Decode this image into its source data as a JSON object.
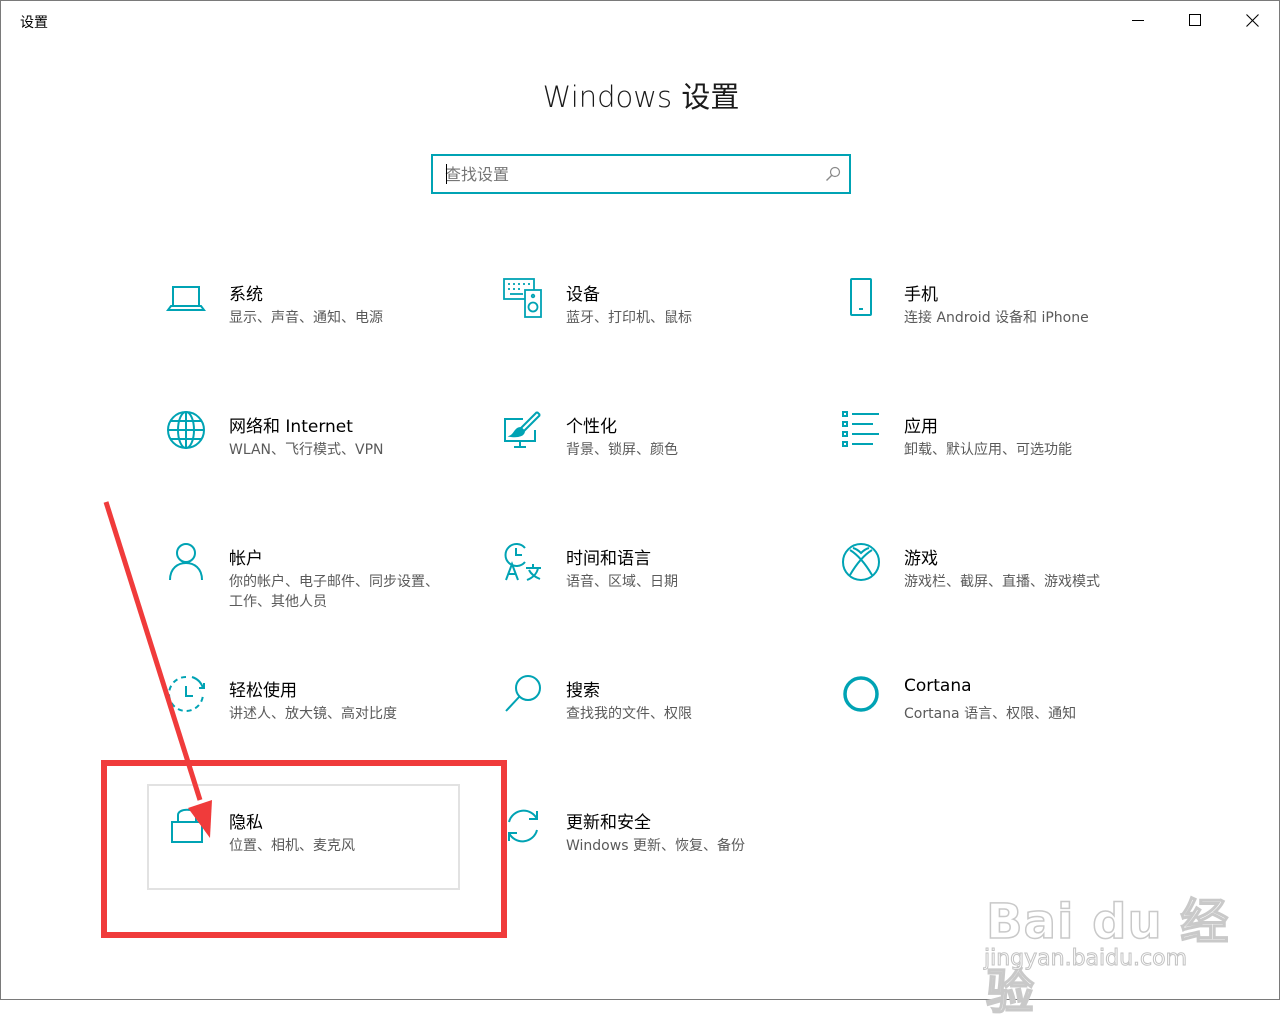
{
  "window": {
    "title": "设置"
  },
  "page": {
    "title": "Windows 设置"
  },
  "search": {
    "placeholder": "查找设置",
    "value": ""
  },
  "tiles": [
    {
      "id": "system",
      "name": "系统",
      "desc": "显示、声音、通知、电源",
      "icon": "laptop-icon"
    },
    {
      "id": "devices",
      "name": "设备",
      "desc": "蓝牙、打印机、鼠标",
      "icon": "keyboard-speaker-icon"
    },
    {
      "id": "phone",
      "name": "手机",
      "desc": "连接 Android 设备和 iPhone",
      "icon": "phone-icon"
    },
    {
      "id": "network",
      "name": "网络和 Internet",
      "desc": "WLAN、飞行模式、VPN",
      "icon": "globe-icon"
    },
    {
      "id": "personalization",
      "name": "个性化",
      "desc": "背景、锁屏、颜色",
      "icon": "paint-brush-icon"
    },
    {
      "id": "apps",
      "name": "应用",
      "desc": "卸载、默认应用、可选功能",
      "icon": "apps-list-icon"
    },
    {
      "id": "accounts",
      "name": "帐户",
      "desc": "你的帐户、电子邮件、同步设置、工作、其他人员",
      "icon": "person-icon"
    },
    {
      "id": "time-language",
      "name": "时间和语言",
      "desc": "语音、区域、日期",
      "icon": "clock-language-icon"
    },
    {
      "id": "gaming",
      "name": "游戏",
      "desc": "游戏栏、截屏、直播、游戏模式",
      "icon": "xbox-icon"
    },
    {
      "id": "ease-of-access",
      "name": "轻松使用",
      "desc": "讲述人、放大镜、高对比度",
      "icon": "ease-of-access-icon"
    },
    {
      "id": "search",
      "name": "搜索",
      "desc": "查找我的文件、权限",
      "icon": "magnifier-icon"
    },
    {
      "id": "cortana",
      "name": "Cortana",
      "desc": "Cortana 语言、权限、通知",
      "icon": "cortana-ring-icon"
    },
    {
      "id": "privacy",
      "name": "隐私",
      "desc": "位置、相机、麦克风",
      "icon": "lock-icon"
    },
    {
      "id": "update-security",
      "name": "更新和安全",
      "desc": "Windows 更新、恢复、备份",
      "icon": "sync-arrows-icon"
    }
  ],
  "watermark": {
    "brand": "Bai du 经验",
    "url": "jingyan.baidu.com"
  },
  "colors": {
    "accent": "#00a3b4",
    "annotation": "#f03b3b"
  }
}
